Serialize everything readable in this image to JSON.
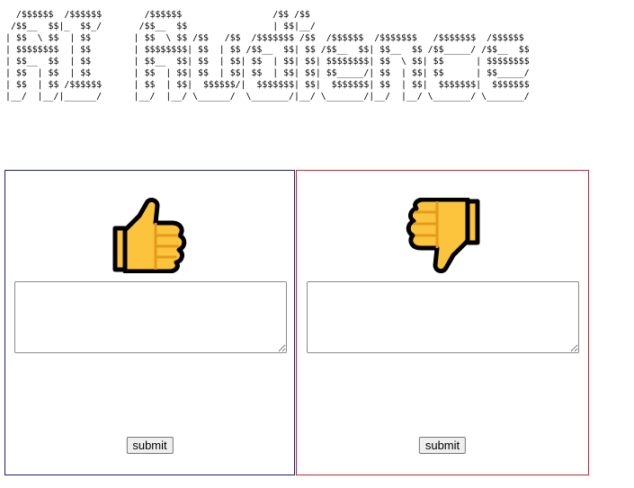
{
  "banner": {
    "ascii_art": "  /$$$$$$  /$$$$$$        /$$$$$$                 /$$ /$$\n /$$__  $$|_  $$_/       /$$__  $$                | $$|__/\n| $$  \\ $$  | $$        | $$  \\ $$ /$$   /$$  /$$$$$$$ /$$  /$$$$$$  /$$$$$$$   /$$$$$$$  /$$$$$$\n| $$$$$$$$  | $$        | $$$$$$$$| $$  | $$ /$$__  $$| $$ /$$__  $$| $$__  $$ /$$_____/ /$$__  $$\n| $$__  $$  | $$        | $$__  $$| $$  | $$| $$  | $$| $$| $$$$$$$$| $$  \\ $$| $$      | $$$$$$$$\n| $$  | $$  | $$        | $$  | $$| $$  | $$| $$  | $$| $$| $$_____/| $$  | $$| $$      | $$_____/\n| $$  | $$ /$$$$$$      | $$  | $$|  $$$$$$/|  $$$$$$$| $$|  $$$$$$$| $$  | $$|  $$$$$$$|  $$$$$$$\n|__/  |__/|______/      |__/  |__/ \\______/  \\_______/|__/ \\_______/|__/  |__/ \\_______/ \\_______/"
  },
  "panels": [
    {
      "id": "like",
      "icon": "thumbs-up-icon",
      "border_color": "#1c1c7a",
      "textarea_value": "",
      "submit_label": "submit"
    },
    {
      "id": "dislike",
      "icon": "thumbs-down-icon",
      "border_color": "#c4242f",
      "textarea_value": "",
      "submit_label": "submit"
    }
  ],
  "colors": {
    "thumb_fill": "#fcc33d",
    "thumb_outline": "#000000",
    "thumb_lines": "#e39b1b"
  }
}
